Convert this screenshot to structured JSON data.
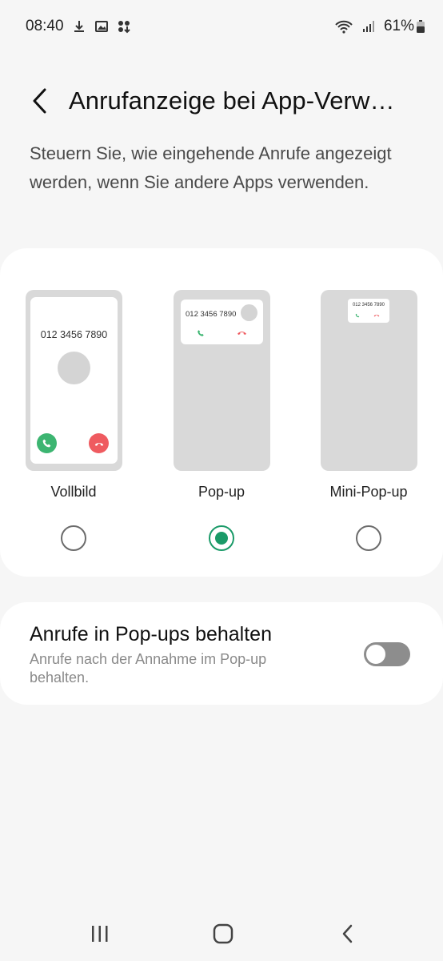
{
  "status_bar": {
    "time": "08:40",
    "battery": "61%",
    "icons": [
      "download-icon",
      "image-icon",
      "apps-icon",
      "wifi-icon",
      "signal-icon",
      "battery-icon"
    ]
  },
  "header": {
    "title": "Anrufanzeige bei App-Verw…",
    "back_icon": "chevron-left-icon"
  },
  "description": "Steuern Sie, wie eingehende Anrufe angezeigt werden, wenn Sie andere Apps verwenden.",
  "options": [
    {
      "label": "Vollbild",
      "selected": false,
      "preview_number": "012 3456 7890"
    },
    {
      "label": "Pop-up",
      "selected": true,
      "preview_number": "012 3456 7890"
    },
    {
      "label": "Mini-Pop-up",
      "selected": false,
      "preview_number": "012 3456 7890"
    }
  ],
  "keep_popup": {
    "title": "Anrufe in Pop-ups behalten",
    "subtitle": "Anrufe nach der Annahme im Pop-up behalten.",
    "enabled": false
  },
  "colors": {
    "accent": "#1a9a68",
    "accept": "#3cb571",
    "reject": "#ef5b60",
    "background": "#f6f6f6"
  },
  "nav_bar": {
    "icons": [
      "recents-icon",
      "home-icon",
      "back-icon"
    ]
  }
}
